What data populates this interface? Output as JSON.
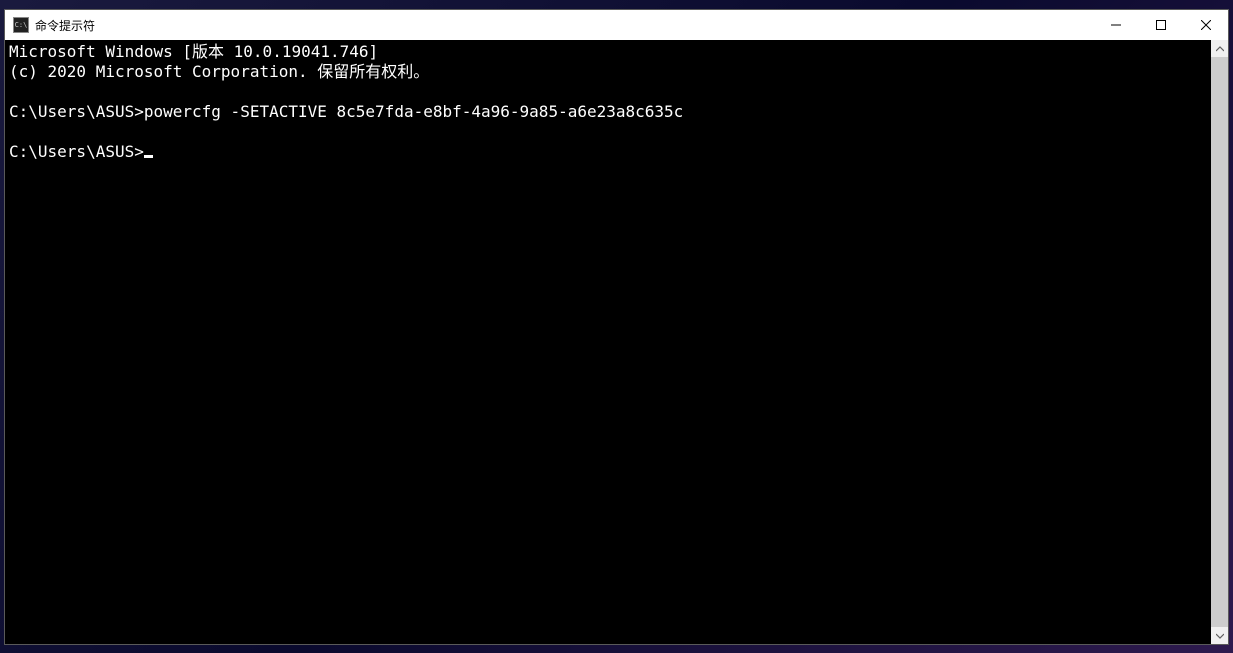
{
  "window": {
    "title": "命令提示符",
    "icon_text": "C:\\"
  },
  "terminal": {
    "lines": [
      "Microsoft Windows [版本 10.0.19041.746]",
      "(c) 2020 Microsoft Corporation. 保留所有权利。",
      "",
      "C:\\Users\\ASUS>powercfg -SETACTIVE 8c5e7fda-e8bf-4a96-9a85-a6e23a8c635c",
      "",
      "C:\\Users\\ASUS>"
    ]
  }
}
